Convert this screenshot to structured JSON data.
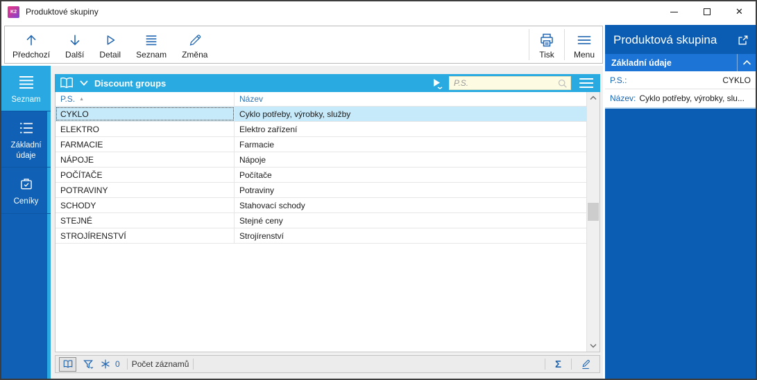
{
  "colors": {
    "accent_cyan": "#29ABE2",
    "dark_blue": "#1061B5",
    "panel_blue": "#0B5DB3",
    "section_blue": "#1B74D6",
    "toolbar_icon_blue": "#2166B1",
    "selected_row": "#C7EAFA",
    "search_bg": "#FDFCE3"
  },
  "window": {
    "logo": "K2",
    "title": "Produktové skupiny",
    "controls": {
      "minimize": "minimize",
      "maximize": "maximize",
      "close": "✕"
    }
  },
  "toolbar": {
    "buttons": [
      {
        "label": "Předchozí",
        "icon": "arrow-up-icon"
      },
      {
        "label": "Další",
        "icon": "arrow-down-icon"
      },
      {
        "label": "Detail",
        "icon": "triangle-right-icon"
      },
      {
        "label": "Seznam",
        "icon": "list-lines-icon"
      },
      {
        "label": "Změna",
        "icon": "pencil-icon"
      }
    ],
    "right_buttons": [
      {
        "label": "Tisk",
        "icon": "printer-icon"
      },
      {
        "label": "Menu",
        "icon": "menu-lines-icon"
      }
    ]
  },
  "sidebar": {
    "items": [
      {
        "label": "Seznam",
        "icon": "list-lines-icon",
        "active": true
      },
      {
        "label": "Základní údaje",
        "icon": "dotted-list-icon",
        "active": false
      },
      {
        "label": "Ceníky",
        "icon": "briefcase-check-icon",
        "active": false
      }
    ]
  },
  "grid": {
    "title": "Discount groups",
    "search_placeholder": "P.S.",
    "columns": [
      {
        "label": "P.S.",
        "sorted": "asc"
      },
      {
        "label": "Název",
        "sorted": null
      }
    ],
    "rows": [
      {
        "ps": "CYKLO",
        "nazev": "Cyklo potřeby, výrobky, služby",
        "selected": true
      },
      {
        "ps": "ELEKTRO",
        "nazev": "Elektro zařízení",
        "selected": false
      },
      {
        "ps": "FARMACIE",
        "nazev": "Farmacie",
        "selected": false
      },
      {
        "ps": "NÁPOJE",
        "nazev": "Nápoje",
        "selected": false
      },
      {
        "ps": "POČÍTAČE",
        "nazev": "Počítače",
        "selected": false
      },
      {
        "ps": "POTRAVINY",
        "nazev": "Potraviny",
        "selected": false
      },
      {
        "ps": "SCHODY",
        "nazev": "Stahovací schody",
        "selected": false
      },
      {
        "ps": "STEJNÉ",
        "nazev": "Stejné ceny",
        "selected": false
      },
      {
        "ps": "STROJÍRENSTVÍ",
        "nazev": "Strojírenství",
        "selected": false
      }
    ]
  },
  "statusbar": {
    "frozen_count": "0",
    "record_count_label": "Počet záznamů",
    "sigma": "Σ"
  },
  "detail_panel": {
    "title": "Produktová skupina",
    "section": "Základní údaje",
    "fields": [
      {
        "label": "P.S.:",
        "value": "CYKLO"
      },
      {
        "label": "Název:",
        "value": "Cyklo potřeby, výrobky, slu..."
      }
    ]
  }
}
